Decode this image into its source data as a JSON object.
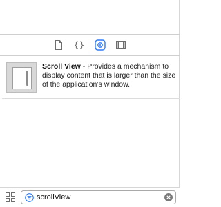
{
  "inspector_tabs": [
    {
      "icon": "file-inspector-icon"
    },
    {
      "icon": "quick-help-icon",
      "glyph": "{}"
    },
    {
      "icon": "object-library-icon",
      "selected": true
    },
    {
      "icon": "media-library-icon"
    }
  ],
  "library_item": {
    "title": "Scroll View",
    "separator": " - ",
    "description": "Provides a mechanism to display content that is larger than the size of the application’s window."
  },
  "filter": {
    "value": "scrollView"
  },
  "colors": {
    "accent": "#2f7bf5",
    "icon_gray": "#6e6e6e"
  }
}
